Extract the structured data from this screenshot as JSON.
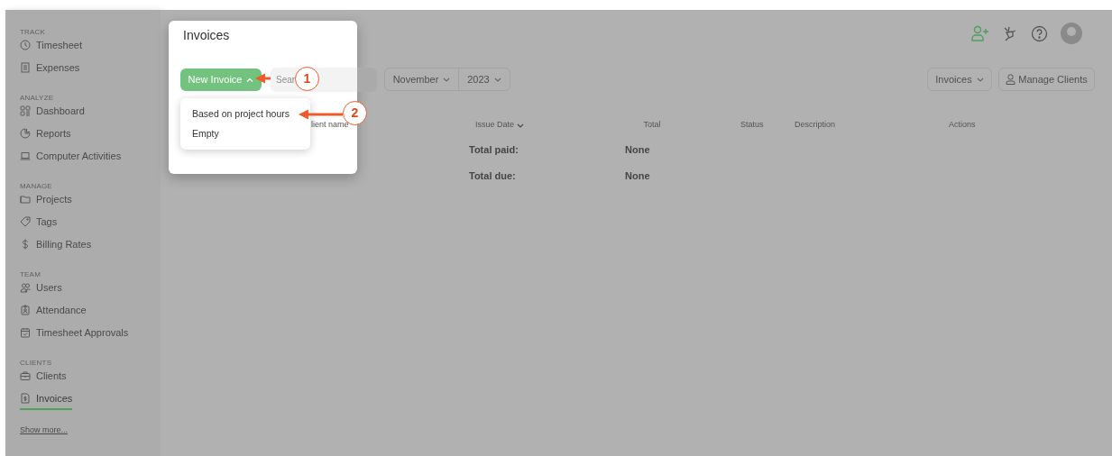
{
  "sidebar": {
    "sections": [
      {
        "label": "TRACK",
        "items": [
          {
            "label": "Timesheet",
            "selected": false
          },
          {
            "label": "Expenses",
            "selected": false
          }
        ]
      },
      {
        "label": "ANALYZE",
        "items": [
          {
            "label": "Dashboard",
            "selected": false
          },
          {
            "label": "Reports",
            "selected": false
          },
          {
            "label": "Computer Activities",
            "selected": false
          }
        ]
      },
      {
        "label": "MANAGE",
        "items": [
          {
            "label": "Projects",
            "selected": false
          },
          {
            "label": "Tags",
            "selected": false
          },
          {
            "label": "Billing Rates",
            "selected": false
          }
        ]
      },
      {
        "label": "TEAM",
        "items": [
          {
            "label": "Users",
            "selected": false
          },
          {
            "label": "Attendance",
            "selected": false
          },
          {
            "label": "Timesheet Approvals",
            "selected": false
          }
        ]
      },
      {
        "label": "CLIENTS",
        "items": [
          {
            "label": "Clients",
            "selected": false
          },
          {
            "label": "Invoices",
            "selected": true
          }
        ]
      }
    ],
    "show_more": "Show more..."
  },
  "dialog": {
    "title": "Invoices",
    "new_invoice_button": "New Invoice",
    "search": {
      "placeholder": "Sear"
    },
    "menu": {
      "items": [
        "Based on project hours",
        "Empty"
      ]
    }
  },
  "filters": {
    "month": "November",
    "year": "2023"
  },
  "toolbar_right": {
    "view_dropdown": "Invoices",
    "manage_clients_button": "Manage Clients"
  },
  "table": {
    "columns": [
      {
        "label": "lient name",
        "sorted": false
      },
      {
        "label": "Issue Date",
        "sorted": true
      },
      {
        "label": "Total",
        "sorted": false
      },
      {
        "label": "Status",
        "sorted": false
      },
      {
        "label": "Description",
        "sorted": false
      },
      {
        "label": "Actions",
        "sorted": false
      }
    ],
    "rows": [
      {
        "label": "Total paid:",
        "total": "None"
      },
      {
        "label": "Total due:",
        "total": "None"
      }
    ]
  },
  "annotations": [
    {
      "number": "1"
    },
    {
      "number": "2"
    }
  ]
}
